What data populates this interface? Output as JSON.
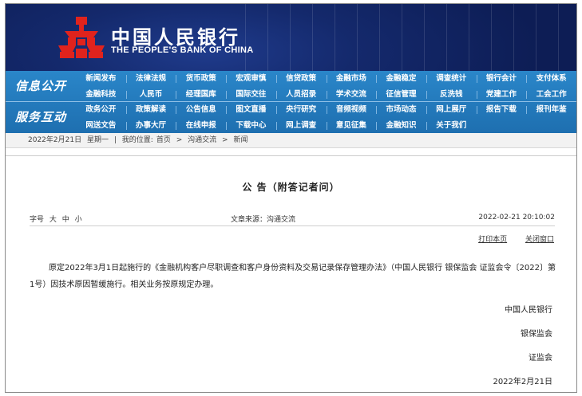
{
  "banner": {
    "bank_name_cn": "中国人民银行",
    "bank_name_en": "THE PEOPLE'S BANK OF CHINA",
    "logo_icon": "pboc-logo-icon",
    "background_color": "#14296c"
  },
  "nav": {
    "sections": [
      {
        "title": "信息公开",
        "items": [
          "新闻发布",
          "法律法规",
          "货币政策",
          "宏观审慎",
          "信贷政策",
          "金融市场",
          "金融稳定",
          "调查统计",
          "银行会计",
          "支付体系",
          "金融科技",
          "人民币",
          "经理国库",
          "国际交往",
          "人员招录",
          "学术交流",
          "征信管理",
          "反洗钱",
          "党建工作",
          "工会工作"
        ]
      },
      {
        "title": "服务互动",
        "items": [
          "政务公开",
          "政策解读",
          "公告信息",
          "图文直播",
          "央行研究",
          "音频视频",
          "市场动态",
          "网上展厅",
          "报告下载",
          "报刊年鉴",
          "网送文告",
          "办事大厅",
          "在线申报",
          "下载中心",
          "网上调查",
          "意见征集",
          "金融知识",
          "关于我们"
        ]
      }
    ],
    "background_color": "#2178bd"
  },
  "breadcrumb": {
    "date": "2022年2月21日",
    "weekday": "星期一",
    "location_label": "我的位置:",
    "path": [
      "首页",
      "沟通交流",
      "新闻"
    ],
    "separator": ">"
  },
  "article": {
    "title": "公 告（附答记者问）",
    "font_size_label": "字号",
    "font_sizes": [
      "大",
      "中",
      "小"
    ],
    "source": "文章来源：沟通交流",
    "datetime": "2022-02-21  20:10:02",
    "print_label": "打印本页",
    "close_label": "关闭窗口",
    "body": "原定2022年3月1日起施行的《金融机构客户尽职调查和客户身份资料及交易记录保存管理办法》（中国人民银行 银保监会 证监会令〔2022〕第1号）因技术原因暂缓施行。相关业务按原规定办理。",
    "signatures": [
      "中国人民银行",
      "银保监会",
      "证监会"
    ],
    "sign_date": "2022年2月21日"
  }
}
